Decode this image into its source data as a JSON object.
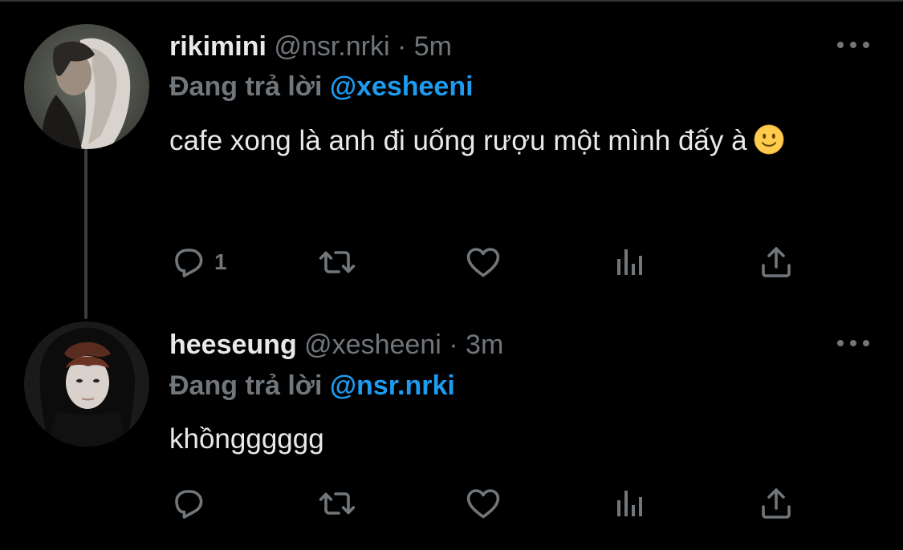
{
  "colors": {
    "background": "#000000",
    "text_primary": "#e7e9ea",
    "text_secondary": "#71767b",
    "link": "#1d9bf0",
    "thread_line": "#3a3d41"
  },
  "tweets": [
    {
      "display_name": "rikimini",
      "handle": "@nsr.nrki",
      "separator": "·",
      "time": "5m",
      "reply_prefix": "Đang trả lời",
      "reply_to": "@xesheeni",
      "text": "cafe xong là anh đi uống rượu một mình đấy à",
      "emoji": "slightly-smiling-face",
      "actions": {
        "reply_count": "1",
        "retweet_count": "",
        "like_count": ""
      },
      "icons": [
        "reply-icon",
        "retweet-icon",
        "like-icon",
        "stats-icon",
        "share-icon",
        "more-icon"
      ]
    },
    {
      "display_name": "heeseung",
      "handle": "@xesheeni",
      "separator": "·",
      "time": "3m",
      "reply_prefix": "Đang trả lời",
      "reply_to": "@nsr.nrki",
      "text": "khồngggggg",
      "actions": {
        "reply_count": "",
        "retweet_count": "",
        "like_count": ""
      },
      "icons": [
        "reply-icon",
        "retweet-icon",
        "like-icon",
        "stats-icon",
        "share-icon",
        "more-icon"
      ]
    }
  ]
}
